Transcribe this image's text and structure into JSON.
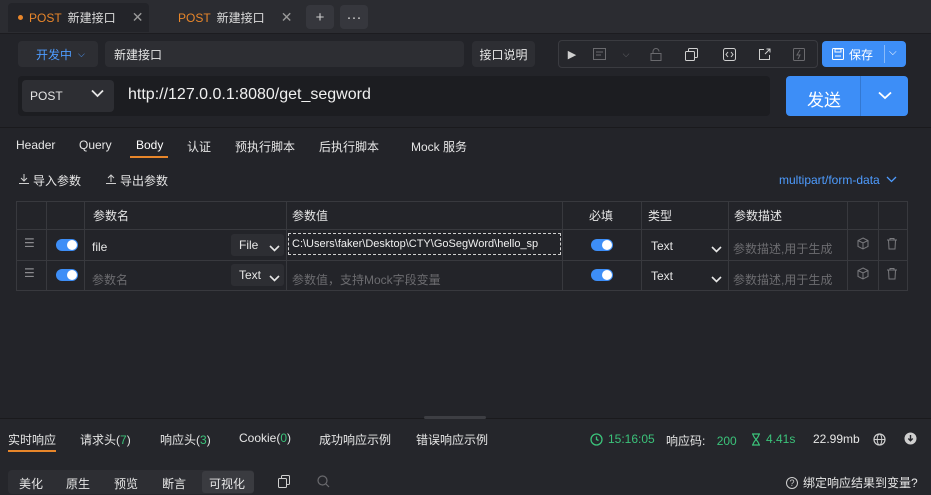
{
  "tabs": [
    {
      "method": "POST",
      "title": "新建接口",
      "close": "✕"
    },
    {
      "method": "POST",
      "title": "新建接口",
      "close": "✕"
    }
  ],
  "tabbar": {
    "add": "+",
    "more": "···"
  },
  "env": {
    "label": "开发中"
  },
  "api_name": "新建接口",
  "doc_button": "接口说明",
  "save_button": "保存",
  "request": {
    "method": "POST",
    "url": "http://127.0.0.1:8080/get_segword",
    "send_label": "发送"
  },
  "request_tabs": [
    "Header",
    "Query",
    "Body",
    "认证",
    "预执行脚本",
    "后执行脚本",
    "Mock 服务"
  ],
  "active_request_tab": "Body",
  "import_label": "导入参数",
  "export_label": "导出参数",
  "content_type": "multipart/form-data",
  "table": {
    "headers": {
      "name": "参数名",
      "value": "参数值",
      "required": "必填",
      "type": "类型",
      "desc": "参数描述"
    },
    "rows": [
      {
        "name": "file",
        "name_placeholder": "",
        "field_type": "File",
        "value": "C:\\Users\\faker\\Desktop\\CTY\\GoSegWord\\hello_sp",
        "required": true,
        "type": "Text",
        "desc_placeholder": "参数描述,用于生成"
      },
      {
        "name": "",
        "name_placeholder": "参数名",
        "field_type": "Text",
        "value_placeholder": "参数值，支持Mock字段变量",
        "required": true,
        "type": "Text",
        "desc_placeholder": "参数描述,用于生成"
      }
    ]
  },
  "response_tabs": [
    {
      "label": "实时响应"
    },
    {
      "label": "请求头",
      "count": "7"
    },
    {
      "label": "响应头",
      "count": "3"
    },
    {
      "label": "Cookie",
      "count": "0"
    },
    {
      "label": "成功响应示例"
    },
    {
      "label": "错误响应示例"
    }
  ],
  "status": {
    "time": "15:16:05",
    "code_label": "响应码:",
    "code": "200",
    "duration": "4.41s",
    "size": "22.99mb"
  },
  "view_tabs": [
    "美化",
    "原生",
    "预览",
    "断言",
    "可视化"
  ],
  "active_view_tab": "可视化",
  "bind_question": "绑定响应结果到变量?",
  "colors": {
    "accent": "#3d8ef7",
    "method": "#e8862a",
    "success": "#3bc27a"
  }
}
